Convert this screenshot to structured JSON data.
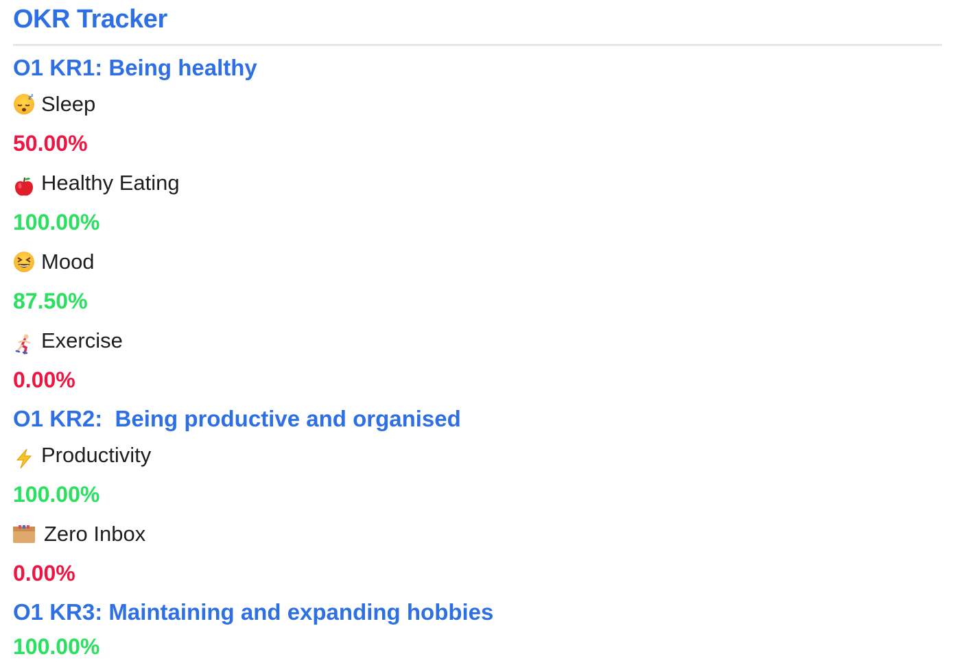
{
  "app": {
    "title": "OKR Tracker"
  },
  "sections": [
    {
      "title": "O1 KR1: Being healthy",
      "items": [
        {
          "icon": "sleeping-face-icon",
          "name": "Sleep",
          "percent": "50.00%",
          "status": "red"
        },
        {
          "icon": "red-apple-icon",
          "name": "Healthy Eating",
          "percent": "100.00%",
          "status": "green"
        },
        {
          "icon": "grinning-squinting-face-icon",
          "name": "Mood",
          "percent": "87.50%",
          "status": "green"
        },
        {
          "icon": "person-running-icon",
          "name": "Exercise",
          "percent": "0.00%",
          "status": "red"
        }
      ]
    },
    {
      "title": "O1 KR2:  Being productive and organised",
      "items": [
        {
          "icon": "high-voltage-icon",
          "name": "Productivity",
          "percent": "100.00%",
          "status": "green"
        },
        {
          "icon": "inbox-box-icon",
          "name": "Zero Inbox",
          "percent": "0.00%",
          "status": "red"
        }
      ]
    },
    {
      "title": "O1 KR3: Maintaining and expanding hobbies",
      "percent": "100.00%",
      "status": "green"
    }
  ],
  "colors": {
    "heading": "#2f6fe4",
    "red": "#ee1542",
    "green": "#29e05f",
    "text": "#1d1d1f",
    "divider": "#e6e6e8"
  }
}
